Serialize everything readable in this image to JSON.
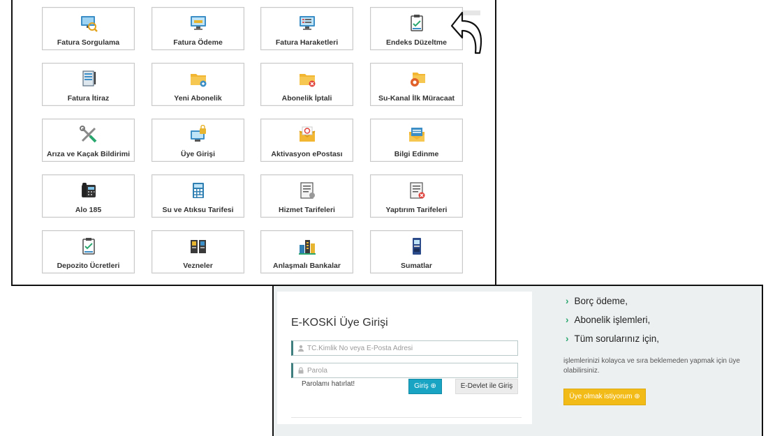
{
  "services": {
    "row1": [
      {
        "label": "Fatura Sorgulama",
        "icon": "monitor-search-icon"
      },
      {
        "label": "Fatura Ödeme",
        "icon": "monitor-payment-icon"
      },
      {
        "label": "Fatura Haraketleri",
        "icon": "monitor-list-icon"
      },
      {
        "label": "Endeks Düzeltme",
        "icon": "clipboard-check-icon"
      }
    ],
    "row2": [
      {
        "label": "Fatura İtiraz",
        "icon": "document-pen-icon"
      },
      {
        "label": "Yeni Abonelik",
        "icon": "folder-add-icon"
      },
      {
        "label": "Abonelik İptali",
        "icon": "folder-cancel-icon"
      },
      {
        "label": "Su-Kanal İlk Müracaat",
        "icon": "folder-gear-icon"
      }
    ],
    "row3": [
      {
        "label": "Arıza ve Kaçak Bildirimi",
        "icon": "tools-icon"
      },
      {
        "label": "Üye Girişi",
        "icon": "monitor-lock-icon"
      },
      {
        "label": "Aktivasyon ePostası",
        "icon": "envelope-at-icon"
      },
      {
        "label": "Bilgi Edinme",
        "icon": "envelope-letter-icon"
      }
    ],
    "row4": [
      {
        "label": "Alo 185",
        "icon": "telephone-icon"
      },
      {
        "label": "Su ve Atıksu Tarifesi",
        "icon": "calculator-icon"
      },
      {
        "label": "Hizmet Tarifeleri",
        "icon": "document-list-icon"
      },
      {
        "label": "Yaptırım Tarifeleri",
        "icon": "document-cancel-icon"
      }
    ],
    "row5": [
      {
        "label": "Depozito Ücretleri",
        "icon": "clipboard-check-icon"
      },
      {
        "label": "Vezneler",
        "icon": "cashier-desk-icon"
      },
      {
        "label": "Anlaşmalı Bankalar",
        "icon": "bank-buildings-icon"
      },
      {
        "label": "Sumatlar",
        "icon": "atm-kiosk-icon"
      }
    ]
  },
  "login": {
    "title": "E-KOSKİ Üye Girişi",
    "username_placeholder": "TC.Kimlik No veya E-Posta Adresi",
    "password_placeholder": "Parola",
    "forgot_label": "Parolamı hatırlat!",
    "login_button": "Giriş ⊕",
    "edevlet_button": "E-Devlet ile Giriş"
  },
  "benefits": {
    "items": [
      "Borç ödeme,",
      "Abonelik işlemleri,",
      "Tüm sorularınız için,"
    ],
    "description": "işlemlerinizi kolayca ve sıra beklemeden yapmak için üye olabilirsiniz.",
    "member_button": "Üye olmak istiyorum ⊕"
  },
  "colors": {
    "login_button": "#1aa4c3",
    "member_button": "#f3bb17",
    "chevron": "#2aa76f",
    "field_accent": "#3f7f7f"
  }
}
